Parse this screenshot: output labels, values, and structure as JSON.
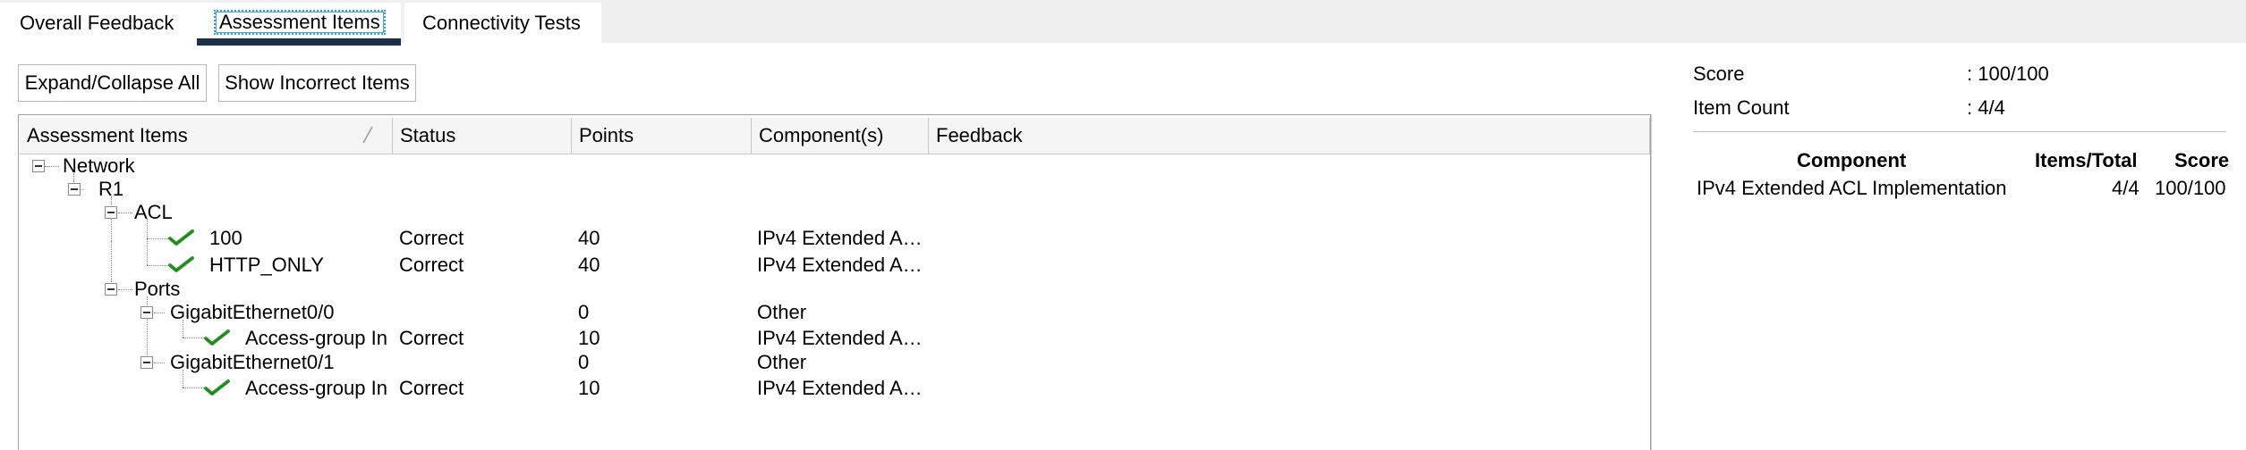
{
  "tabs": {
    "overall": "Overall Feedback",
    "assessment": "Assessment Items",
    "connectivity": "Connectivity Tests"
  },
  "toolbar": {
    "expand_collapse": "Expand/Collapse All",
    "show_incorrect": "Show Incorrect Items"
  },
  "grid": {
    "columns": [
      "Assessment Items",
      "Status",
      "Points",
      "Component(s)",
      "Feedback"
    ],
    "rows": [
      {
        "name": "Network",
        "status": "",
        "points": "",
        "component": "",
        "check": false
      },
      {
        "name": "R1",
        "status": "",
        "points": "",
        "component": "",
        "check": false
      },
      {
        "name": "ACL",
        "status": "",
        "points": "",
        "component": "",
        "check": false
      },
      {
        "name": "100",
        "status": "Correct",
        "points": "40",
        "component": "IPv4 Extended A…",
        "check": true
      },
      {
        "name": "HTTP_ONLY",
        "status": "Correct",
        "points": "40",
        "component": "IPv4 Extended A…",
        "check": true
      },
      {
        "name": "Ports",
        "status": "",
        "points": "",
        "component": "",
        "check": false
      },
      {
        "name": "GigabitEthernet0/0",
        "status": "",
        "points": "0",
        "component": "Other",
        "check": false
      },
      {
        "name": "Access-group In",
        "status": "Correct",
        "points": "10",
        "component": "IPv4 Extended A…",
        "check": true
      },
      {
        "name": "GigabitEthernet0/1",
        "status": "",
        "points": "0",
        "component": "Other",
        "check": false
      },
      {
        "name": "Access-group In",
        "status": "Correct",
        "points": "10",
        "component": "IPv4 Extended A…",
        "check": true
      }
    ]
  },
  "summary": {
    "score_label": "Score",
    "score_value": ": 100/100",
    "count_label": "Item Count",
    "count_value": ": 4/4",
    "table_headers": [
      "Component",
      "Items/Total",
      "Score"
    ],
    "table_rows": [
      {
        "component": "IPv4 Extended ACL Implementation",
        "items": "4/4",
        "score": "100/100"
      }
    ]
  },
  "colors": {
    "tab_underline": "#1c2f4a",
    "focus_outline": "#46a8e0",
    "check_green": "#2f9e2f"
  }
}
